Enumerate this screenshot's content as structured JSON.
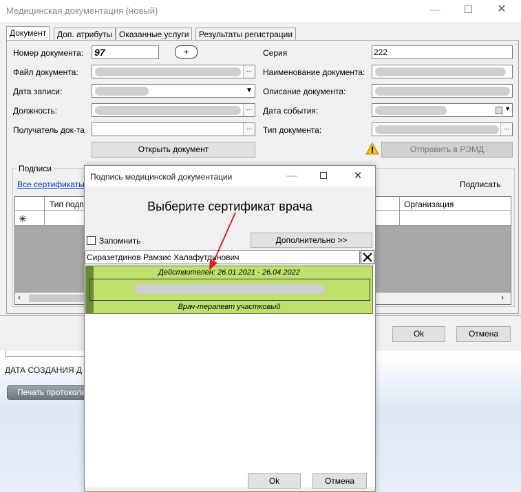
{
  "main_window": {
    "title": "Медицинская документация (новый)",
    "tabs": [
      "Документ",
      "Доп. атрибуты",
      "Оказанные услуги",
      "Результаты регистрации"
    ],
    "fields": {
      "doc_number_label": "Номер документа:",
      "doc_number_value": "97",
      "add_button": "+",
      "file_label": "Файл документа:",
      "record_date_label": "Дата записи:",
      "position_label": "Должность:",
      "recipient_label": "Получатель док-та",
      "series_label": "Серия",
      "series_value": "222",
      "doc_name_label": "Наименование документа:",
      "description_label": "Описание документа:",
      "event_date_label": "Дата события:",
      "doc_type_label": "Тип документа:"
    },
    "open_document_button": "Открыть документ",
    "send_remd_button": "Отправить в РЭМД",
    "signatures": {
      "group_label": "Подписи",
      "all_certs_link": "Все сертификаты",
      "sign_link": "Подписать",
      "columns": [
        "Тип подписи",
        "Организация"
      ],
      "new_row_marker": "✳"
    },
    "ok_button": "Ok",
    "cancel_button": "Отмена"
  },
  "background_page": {
    "creation_date_label": "ДАТА СОЗДАНИЯ Д",
    "print_button": "Печать протокола"
  },
  "sign_dialog": {
    "title": "Подпись медицинской документации",
    "heading": "Выберите сертификат врача",
    "remember_label": "Запомнить",
    "remember_checked": false,
    "advanced_button": "Дополнительно >>",
    "search_value": "Сиразетдинов Рамзис Халафутдинович",
    "clear_icon": "close-icon",
    "certificate": {
      "validity": "Действителен: 26.01.2021 - 26.04.2022",
      "role": "Врач-терапевт участковый"
    },
    "ok_button": "Ok",
    "cancel_button": "Отмена"
  },
  "colors": {
    "certificate_bg": "#bfe06f",
    "arrow": "#e02020",
    "link": "#0033cc"
  }
}
